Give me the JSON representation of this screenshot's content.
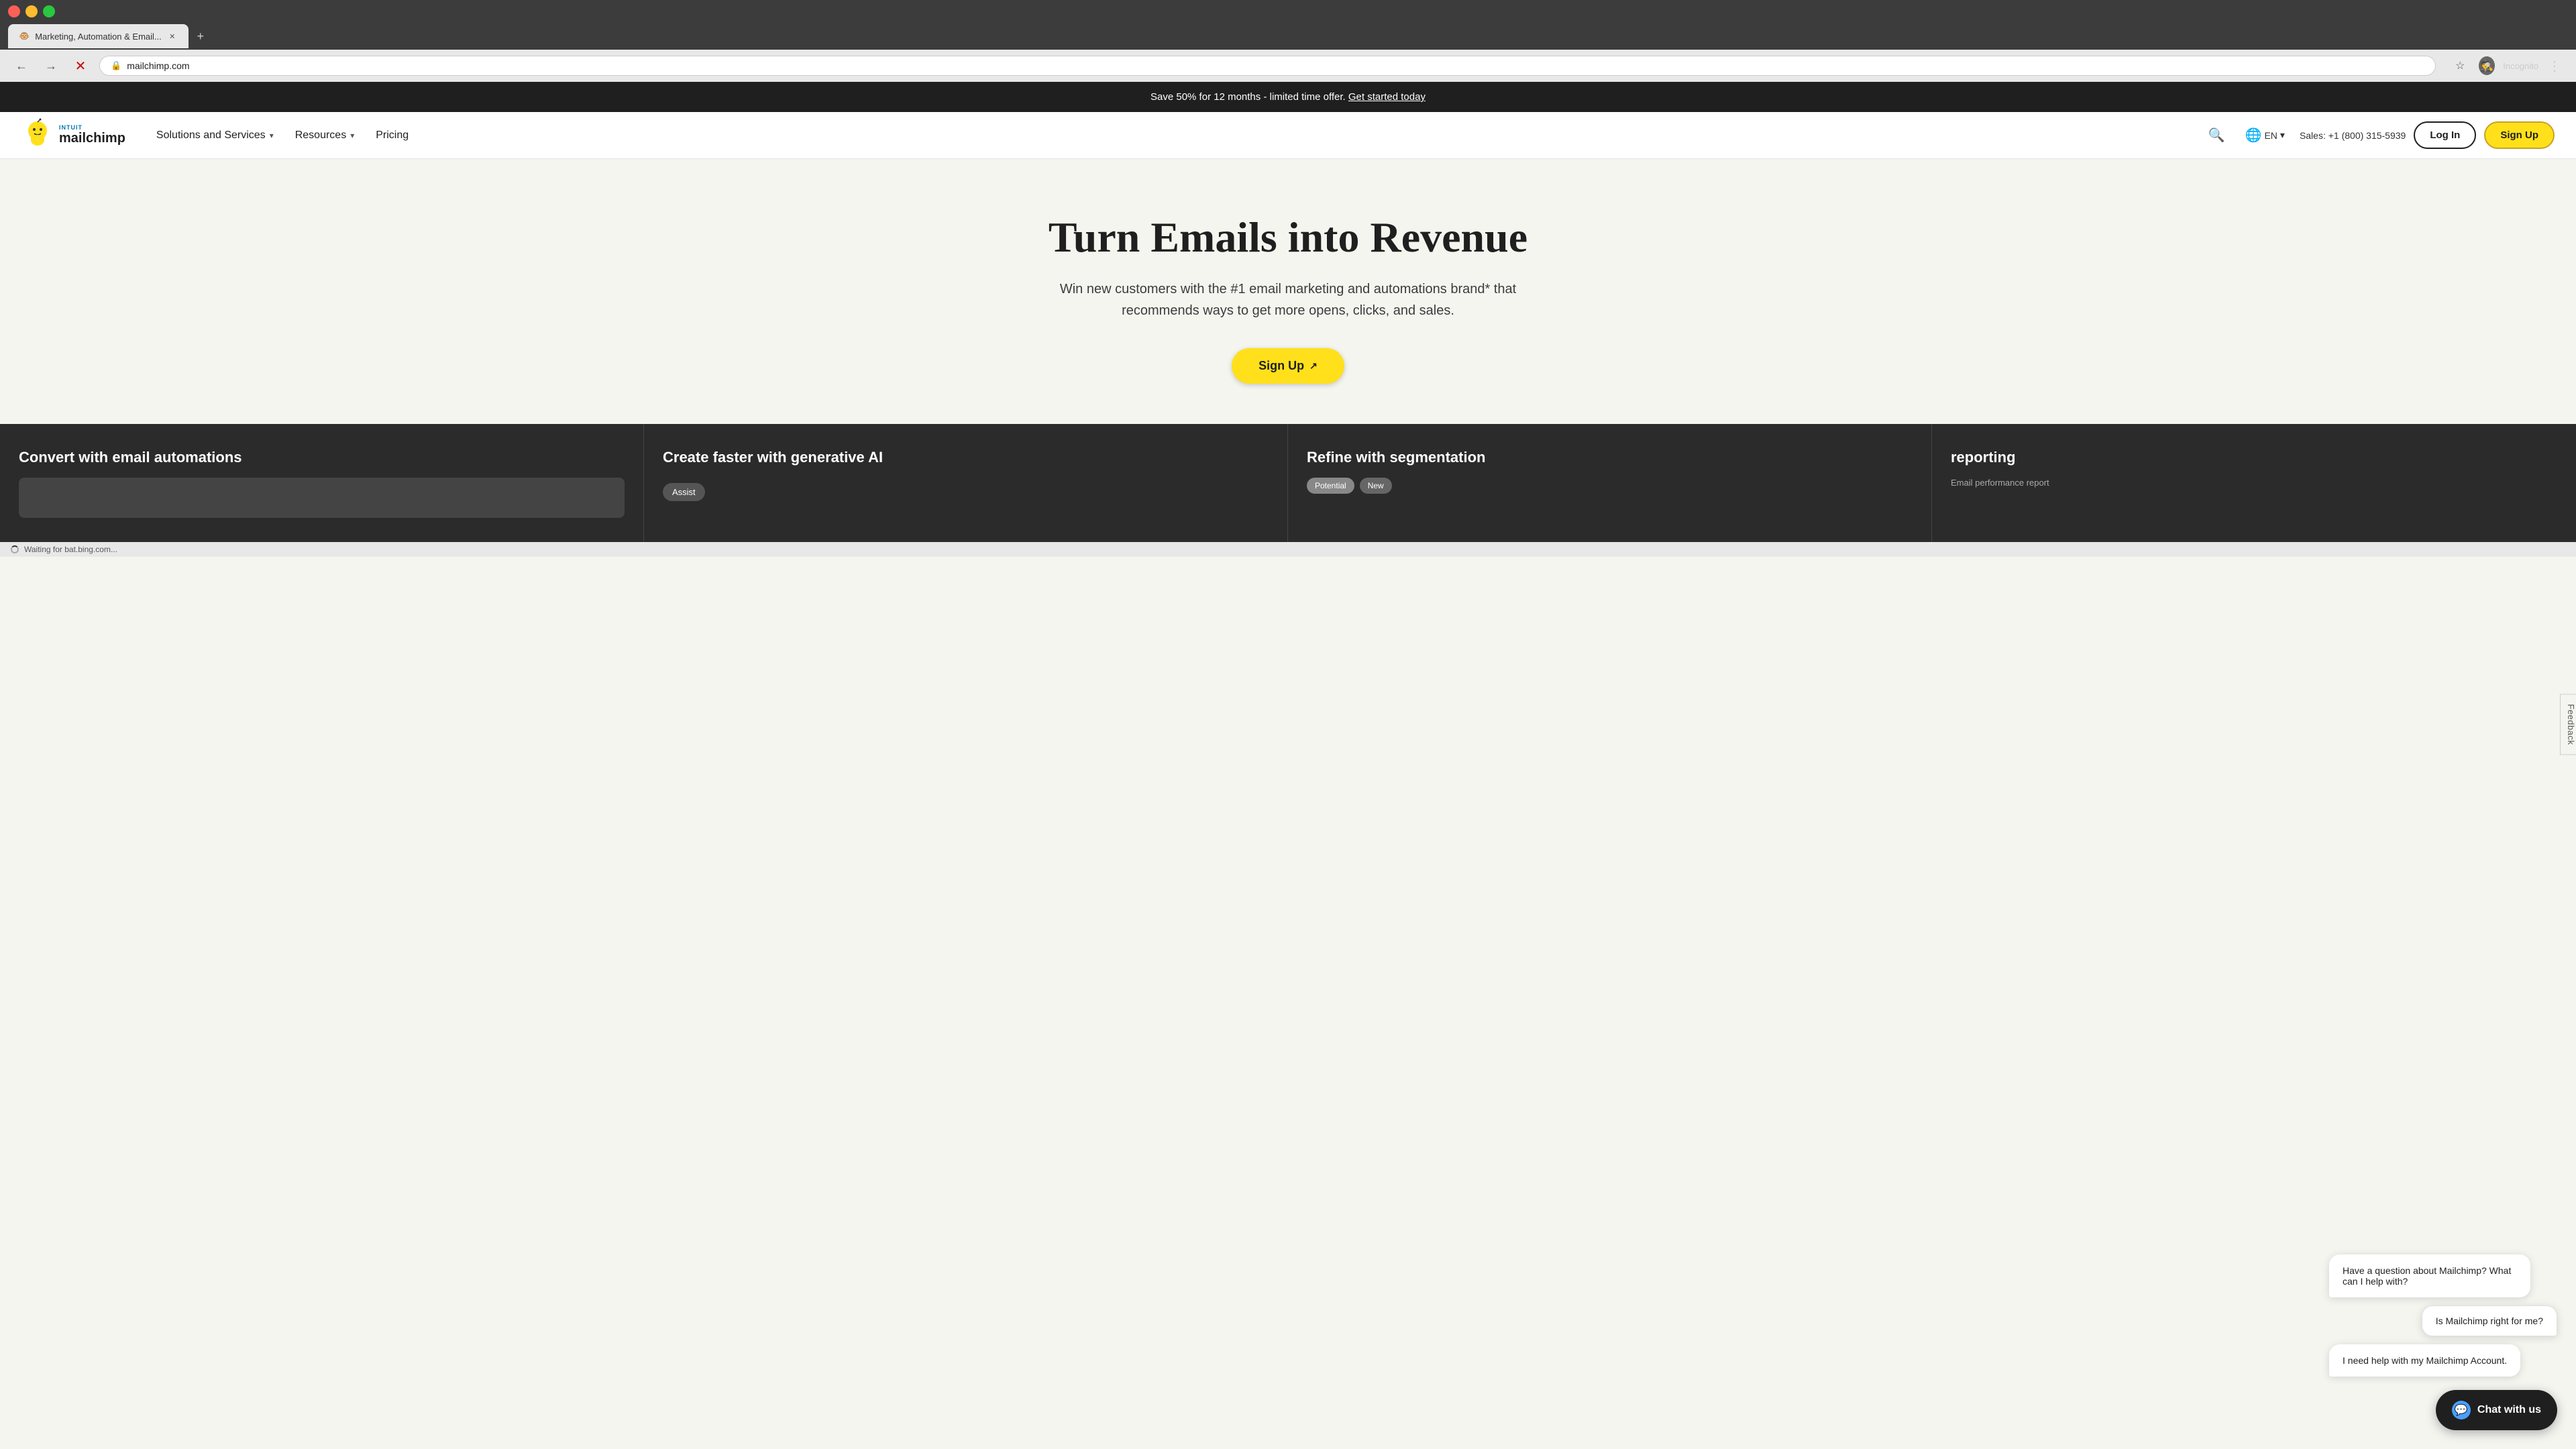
{
  "browser": {
    "tab_title": "Marketing, Automation & Email...",
    "url": "mailchimp.com",
    "loading_status": "Waiting for bat.bing.com...",
    "incognito_label": "Incognito"
  },
  "announcement": {
    "text": "Save 50% for 12 months",
    "subtext": "- limited time offer.",
    "cta": "Get started today"
  },
  "nav": {
    "logo_text": "INTUIT\nmailchimp",
    "solutions_label": "Solutions and Services",
    "resources_label": "Resources",
    "pricing_label": "Pricing",
    "search_label": "Search",
    "lang_label": "EN",
    "sales_text": "Sales: +1 (800) 315-5939",
    "login_label": "Log In",
    "signup_label": "Sign Up"
  },
  "hero": {
    "title": "Turn Emails into Revenue",
    "subtitle": "Win new customers with the #1 email marketing and automations brand* that recommends ways to get more opens, clicks, and sales.",
    "signup_label": "Sign Up"
  },
  "features": [
    {
      "title": "Convert with email automations",
      "badge": ""
    },
    {
      "title": "Create faster with generative AI",
      "badge": "Assist"
    },
    {
      "title": "Refine with segmentation",
      "badge_left": "Potential",
      "badge_right": "New"
    },
    {
      "title": "reporting",
      "subtitle": "Email performance report",
      "badge": ""
    }
  ],
  "chat": {
    "question": "Have a question about Mailchimp? What can I help with?",
    "suggestion1": "Is Mailchimp right for me?",
    "suggestion2": "I need help with my Mailchimp Account.",
    "button_label": "Chat with us"
  },
  "feedback": {
    "label": "Feedback"
  }
}
